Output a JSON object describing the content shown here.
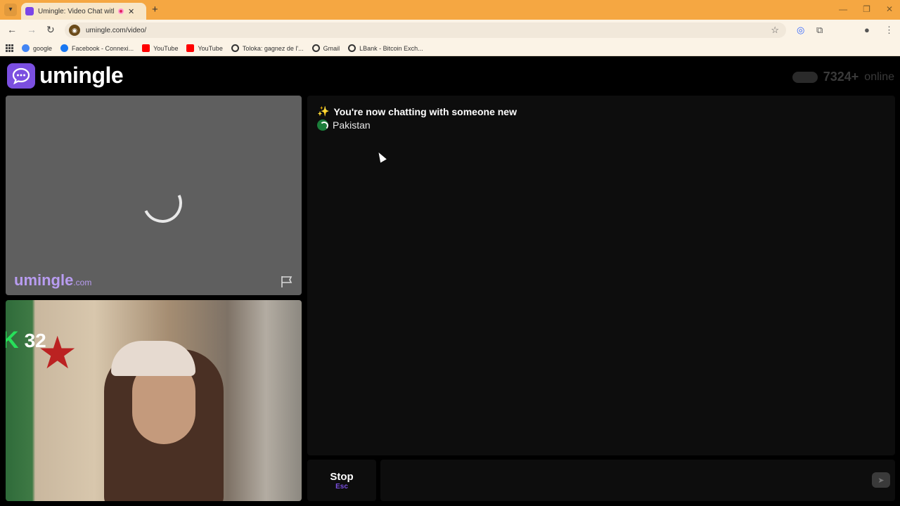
{
  "browser": {
    "tab_title": "Umingle: Video Chat with S",
    "tab_close": "✕",
    "new_tab": "+",
    "url": "umingle.com/video/",
    "bookmarks": [
      {
        "label": "google",
        "color": "#4285f4"
      },
      {
        "label": "Facebook - Connexi...",
        "color": "#1877f2"
      },
      {
        "label": "YouTube",
        "color": "#ff0000"
      },
      {
        "label": "YouTube",
        "color": "#ff0000"
      },
      {
        "label": "Toloka: gagnez de l'...",
        "color": "#333333"
      },
      {
        "label": "Gmail",
        "color": "#333333"
      },
      {
        "label": "LBank - Bitcoin Exch...",
        "color": "#333333"
      }
    ],
    "window_controls": [
      "—",
      "❐",
      "✕"
    ]
  },
  "app": {
    "logo_text": "umingle",
    "online_count": "7324+",
    "online_label": "online",
    "brand_color": "#7b4fe0",
    "watermark_main": "umingle",
    "watermark_sub": ".com",
    "self_badge_logo": "K",
    "self_badge_number": "32",
    "chat": {
      "system_message": "You're now chatting with someone new",
      "sparkle_icon": "✨",
      "country": "Pakistan"
    },
    "stop_button": {
      "label": "Stop",
      "shortcut": "Esc"
    },
    "send_icon": "➤"
  }
}
